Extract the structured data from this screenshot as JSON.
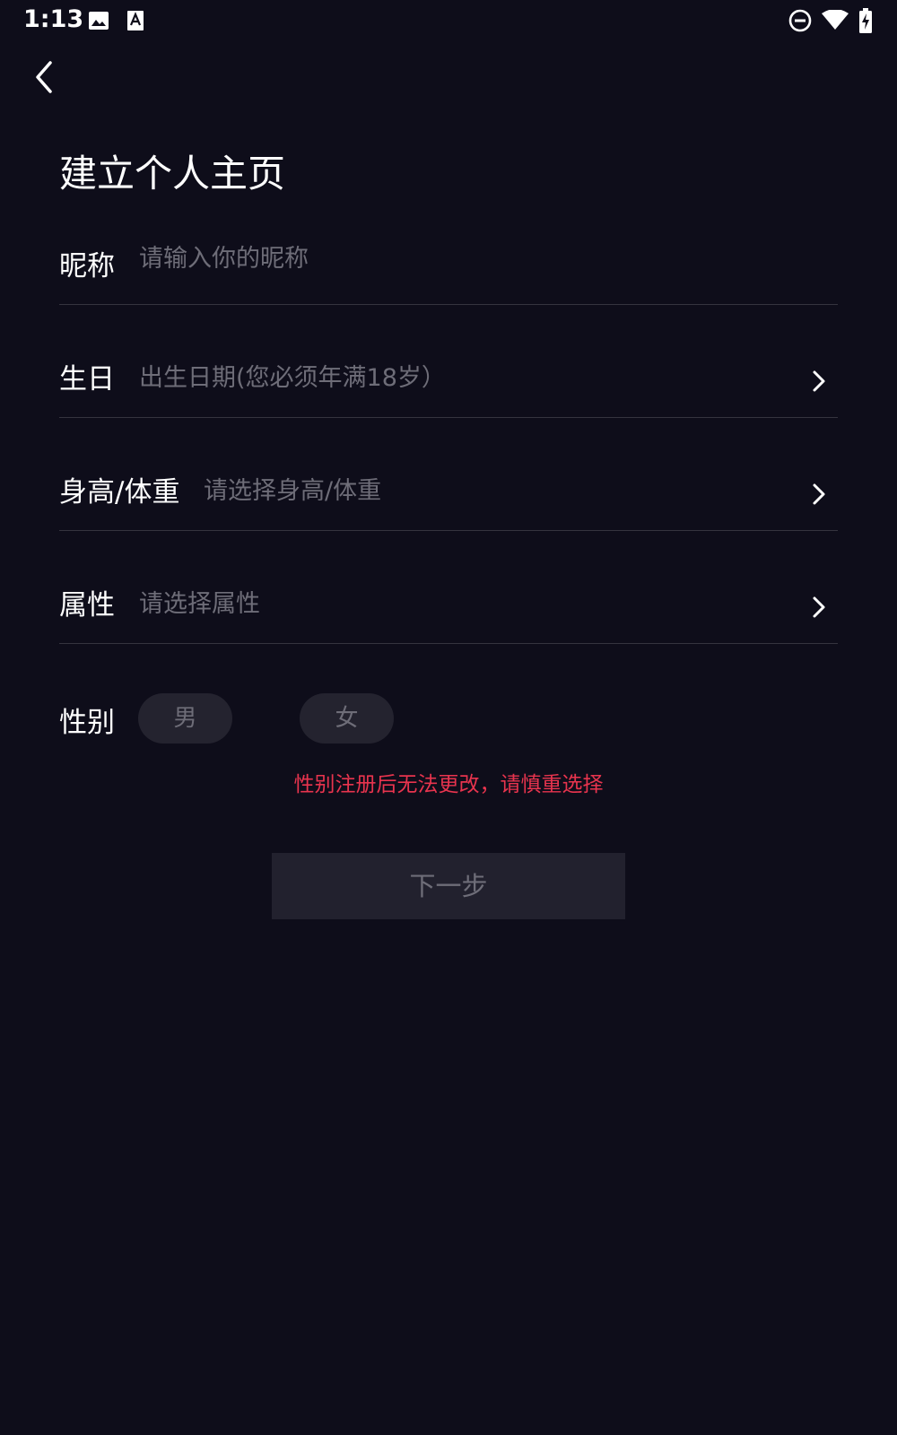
{
  "status_bar": {
    "time": "1:13",
    "left_icons": [
      "image-icon",
      "font-a-icon"
    ],
    "right_icons": [
      "do-not-disturb-icon",
      "wifi-icon",
      "battery-charging-icon"
    ]
  },
  "header": {
    "back_icon": "chevron-left-icon"
  },
  "title": "建立个人主页",
  "fields": {
    "nickname": {
      "label": "昵称",
      "placeholder": "请输入你的昵称"
    },
    "birthday": {
      "label": "生日",
      "placeholder": "出生日期(您必须年满18岁）"
    },
    "height_weight": {
      "label": "身高/体重",
      "placeholder": "请选择身高/体重"
    },
    "attribute": {
      "label": "属性",
      "placeholder": "请选择属性"
    }
  },
  "gender": {
    "label": "性别",
    "options": [
      "男",
      "女"
    ],
    "warning": "性别注册后无法更改，请慎重选择"
  },
  "next_button": "下一步",
  "colors": {
    "background": "#0e0d1a",
    "divider": "#35343f",
    "placeholder": "#6e6d78",
    "pill": "#24232f",
    "button": "#22212e",
    "warning": "#e8344e"
  }
}
